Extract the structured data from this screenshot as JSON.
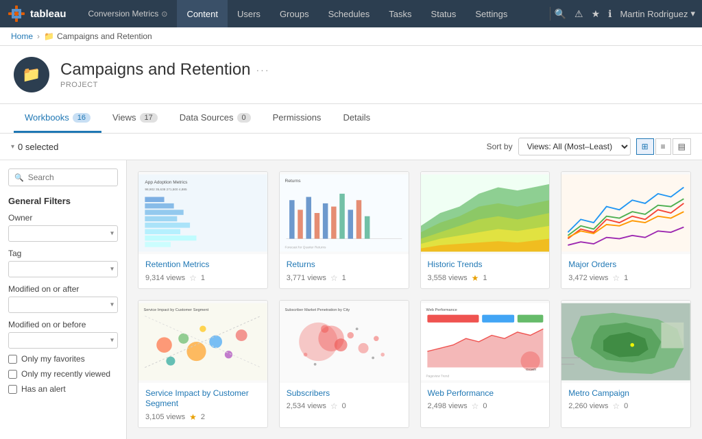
{
  "topnav": {
    "logo_text": "tableau",
    "workbook_link": "Conversion Metrics",
    "workbook_icon": "⊙",
    "nav_items": [
      {
        "label": "Content",
        "active": true
      },
      {
        "label": "Users",
        "active": false
      },
      {
        "label": "Groups",
        "active": false
      },
      {
        "label": "Schedules",
        "active": false
      },
      {
        "label": "Tasks",
        "active": false
      },
      {
        "label": "Status",
        "active": false
      },
      {
        "label": "Settings",
        "active": false
      }
    ],
    "user_name": "Martin Rodriguez"
  },
  "breadcrumb": {
    "home": "Home",
    "current": "Campaigns and Retention"
  },
  "project": {
    "name": "Campaigns and Retention",
    "subtitle": "PROJECT",
    "more_label": "···"
  },
  "tabs": [
    {
      "label": "Workbooks",
      "count": "16",
      "active": true
    },
    {
      "label": "Views",
      "count": "17",
      "active": false
    },
    {
      "label": "Data Sources",
      "count": "0",
      "active": false
    },
    {
      "label": "Permissions",
      "count": "",
      "active": false
    },
    {
      "label": "Details",
      "count": "",
      "active": false
    }
  ],
  "toolbar": {
    "selected_text": "0 selected",
    "sort_label": "Sort by",
    "sort_option": "Views: All (Most–Least)"
  },
  "sidebar": {
    "search_placeholder": "Search",
    "filters_title": "General Filters",
    "owner_label": "Owner",
    "tag_label": "Tag",
    "modified_after_label": "Modified on or after",
    "modified_before_label": "Modified on or before",
    "checkboxes": [
      {
        "label": "Only my favorites"
      },
      {
        "label": "Only my recently viewed"
      },
      {
        "label": "Has an alert"
      }
    ]
  },
  "workbooks": [
    {
      "name": "Retention Metrics",
      "views": "9,314 views",
      "star_filled": false,
      "star_count": "1",
      "thumb_type": "retention"
    },
    {
      "name": "Returns",
      "views": "3,771 views",
      "star_filled": false,
      "star_count": "1",
      "thumb_type": "returns"
    },
    {
      "name": "Historic Trends",
      "views": "3,558 views",
      "star_filled": true,
      "star_count": "1",
      "thumb_type": "historic"
    },
    {
      "name": "Major Orders",
      "views": "3,472 views",
      "star_filled": false,
      "star_count": "1",
      "thumb_type": "major"
    },
    {
      "name": "Service Impact by Customer Segment",
      "views": "3,105 views",
      "star_filled": true,
      "star_count": "2",
      "thumb_type": "service"
    },
    {
      "name": "Subscribers",
      "views": "2,534 views",
      "star_filled": false,
      "star_count": "0",
      "thumb_type": "subscribers"
    },
    {
      "name": "Web Performance",
      "views": "2,498 views",
      "star_filled": false,
      "star_count": "0",
      "thumb_type": "webperf"
    },
    {
      "name": "Metro Campaign",
      "views": "2,260 views",
      "star_filled": false,
      "star_count": "0",
      "thumb_type": "metro"
    }
  ]
}
